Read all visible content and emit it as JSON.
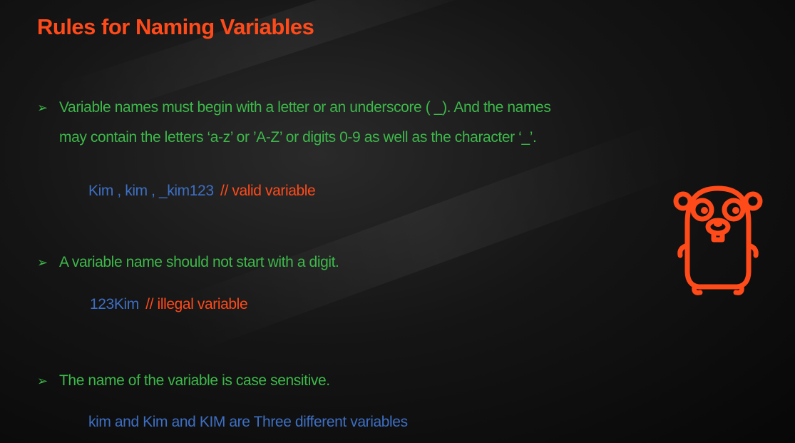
{
  "colors": {
    "title": "#ff4a1a",
    "bullet_text": "#3db84a",
    "code": "#3d6fc4",
    "comment": "#ff4a1a",
    "gopher": "#ff4a1a"
  },
  "title": "Rules for Naming Variables",
  "bullet_icon": "arrow-bullet-icon",
  "rules": [
    {
      "lines": [
        "Variable names must begin with a letter or an underscore ( _).  And the names",
        "may contain the letters ‘a-z’ or ’A-Z’ or digits 0-9 as well as the character ‘_’."
      ],
      "example_code": "Kim , kim , _kim123",
      "example_comment": "// valid variable"
    },
    {
      "lines": [
        "A variable name should not start with a digit."
      ],
      "example_code": "123Kim",
      "example_comment": "// illegal variable"
    },
    {
      "lines": [
        "The name of the variable is case sensitive."
      ],
      "example_code": "kim and Kim and KIM are Three different variables",
      "example_comment": ""
    }
  ],
  "logo": "go-gopher-icon"
}
